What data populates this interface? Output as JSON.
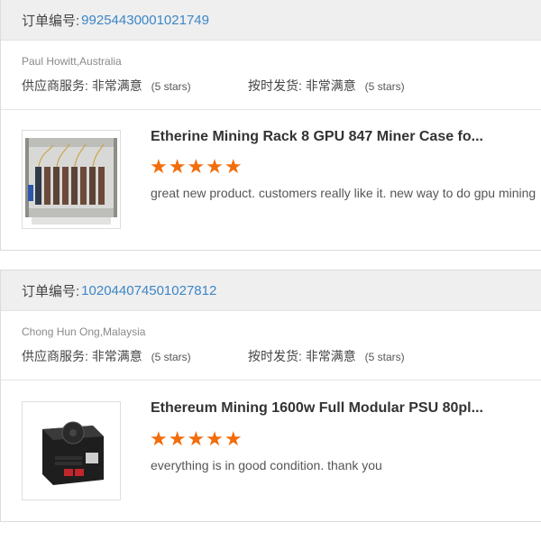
{
  "reviews": [
    {
      "order_label": "订单编号:",
      "order_number": "99254430001021749",
      "buyer": "Paul Howitt,Australia",
      "supplier_service_label": "供应商服务:",
      "supplier_service_value": "非常满意",
      "supplier_service_stars": "(5 stars)",
      "shipping_label": "按时发货:",
      "shipping_value": "非常满意",
      "shipping_stars": "(5 stars)",
      "product_title": "Etherine Mining Rack 8 GPU 847 Miner Case fo...",
      "rating_stars": "★★★★★",
      "comment": "great new product.  customers really like it. new way to do gpu mining"
    },
    {
      "order_label": "订单编号:",
      "order_number": "102044074501027812",
      "buyer": "Chong Hun Ong,Malaysia",
      "supplier_service_label": "供应商服务:",
      "supplier_service_value": "非常满意",
      "supplier_service_stars": "(5 stars)",
      "shipping_label": "按时发货:",
      "shipping_value": "非常满意",
      "shipping_stars": "(5 stars)",
      "product_title": "Ethereum Mining 1600w Full Modular PSU 80pl...",
      "rating_stars": "★★★★★",
      "comment": "everything is in good condition. thank you"
    }
  ],
  "colors": {
    "accent_link": "#3d86c6",
    "star": "#f26d0c",
    "header_bg": "#efefef"
  }
}
